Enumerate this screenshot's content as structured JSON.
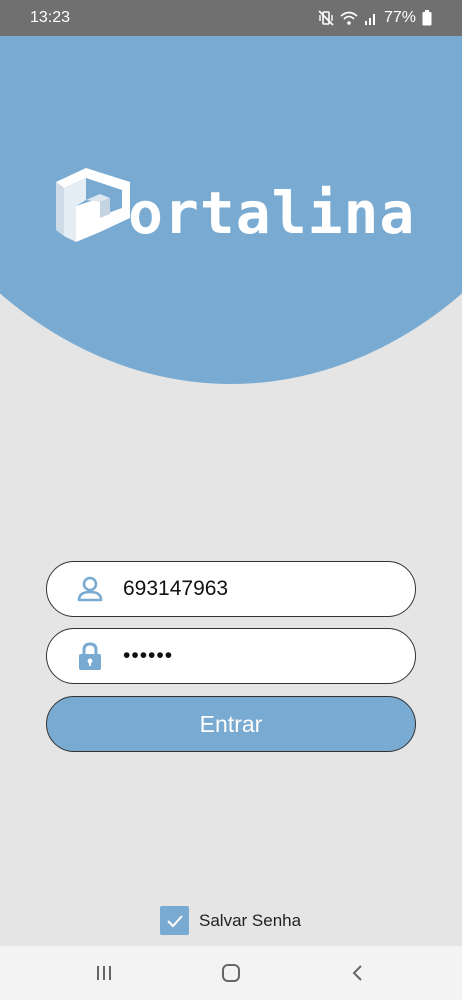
{
  "status_bar": {
    "time": "13:23",
    "battery": "77%",
    "icons": [
      "mute-vibrate-icon",
      "wifi-icon",
      "signal-icon",
      "battery-icon"
    ]
  },
  "brand": {
    "logo_text": "ortalina",
    "logo_icon": "cube-p-logo"
  },
  "login": {
    "user_icon": "user-icon",
    "user_value": "693147963",
    "password_icon": "lock-icon",
    "password_value": "••••••",
    "submit_label": "Entrar"
  },
  "save_password": {
    "checked": true,
    "label": "Salvar Senha"
  },
  "nav": {
    "icons": [
      "recents-icon",
      "home-icon",
      "back-icon"
    ]
  },
  "colors": {
    "accent": "#79aad1",
    "background": "#e5e5e5",
    "status_bar": "#707070",
    "nav_bar": "#f3f3f3"
  }
}
